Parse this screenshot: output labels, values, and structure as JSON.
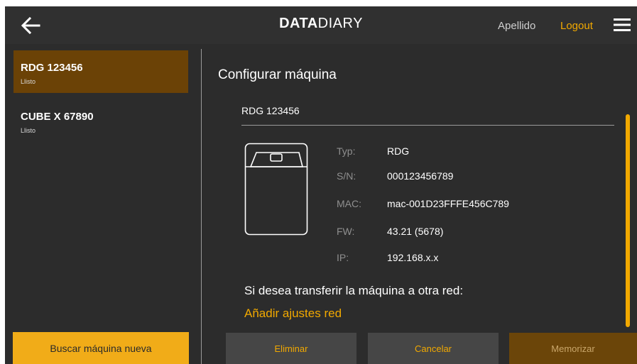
{
  "header": {
    "brand_bold": "DATA",
    "brand_light": "DIARY",
    "user": "Apellido",
    "logout": "Logout",
    "icons": {
      "back": "arrow-left-icon",
      "menu": "hamburger-menu-icon"
    }
  },
  "sidebar": {
    "items": [
      {
        "name": "RDG 123456",
        "status": "Llisto",
        "selected": true
      },
      {
        "name": "CUBE X 67890",
        "status": "Llisto",
        "selected": false
      }
    ],
    "search_button": "Buscar máquina nueva"
  },
  "main": {
    "title": "Configurar máquina",
    "machine_name": "RDG 123456",
    "specs": [
      {
        "label": "Typ:",
        "value": "RDG"
      },
      {
        "label": "S/N:",
        "value": "000123456789"
      },
      {
        "label": "MAC:",
        "value": "mac-001D23FFFE456C789"
      },
      {
        "label": "FW:",
        "value": "43.21 (5678)"
      },
      {
        "label": "IP:",
        "value": "192.168.x.x"
      }
    ],
    "transfer_text": "Si desea transferir la máquina a otra red:",
    "add_network_link": "Añadir ajustes red"
  },
  "actions": {
    "delete": "Eliminar",
    "cancel": "Cancelar",
    "save": "Memorizar"
  },
  "colors": {
    "background": "#2c2c2c",
    "header": "#303030",
    "accent": "#f2a900",
    "selected_item": "#6b4206",
    "button_dark": "#464646",
    "button_save": "#6b4509"
  }
}
